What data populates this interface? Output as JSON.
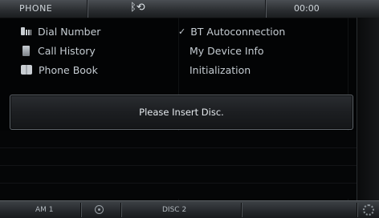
{
  "status_bar": {
    "title": "PHONE",
    "clock": "00:00"
  },
  "menu": {
    "left_items": [
      {
        "label": "Dial Number",
        "icon": "keypad-icon"
      },
      {
        "label": "Call History",
        "icon": "call-history-icon"
      },
      {
        "label": "Phone Book",
        "icon": "phone-book-icon"
      }
    ],
    "right_items": [
      {
        "label": "BT Autoconnection",
        "checked": true
      },
      {
        "label": "My Device Info"
      },
      {
        "label": "Initialization"
      }
    ]
  },
  "dialog": {
    "message": "Please Insert Disc."
  },
  "bottom_bar": {
    "left": "AM 1",
    "center": "DISC 2"
  }
}
